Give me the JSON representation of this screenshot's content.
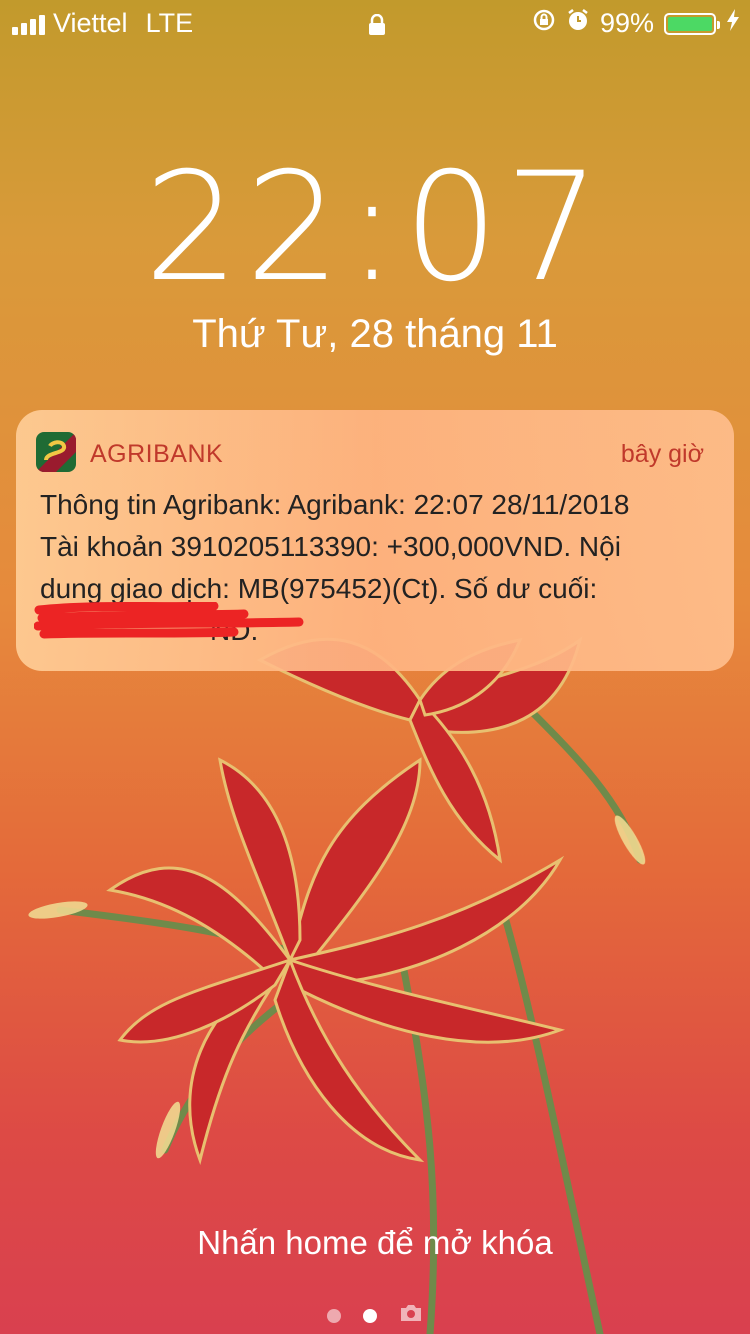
{
  "status_bar": {
    "carrier": "Viettel",
    "network": "LTE",
    "battery_percent": "99%",
    "battery_level": 0.99
  },
  "lock_screen": {
    "time": "22:07",
    "date": "Thứ Tư, 28 tháng 11",
    "unlock_hint": "Nhấn home để mở khóa"
  },
  "notification": {
    "app_name": "AGRIBANK",
    "time": "bây giờ",
    "lines": [
      "Thông tin Agribank: Agribank: 22:07 28/11/2018",
      "Tài khoản 3910205113390: +300,000VND. Nội",
      "dung giao dịch: MB(975452)(Ct). Số dư cuối:",
      "ND."
    ]
  },
  "colors": {
    "accent_red": "#c0392b",
    "battery_green": "#4cd964"
  },
  "page_indicator": {
    "pages": 3,
    "active_index": 1,
    "last_icon": "camera-icon"
  }
}
